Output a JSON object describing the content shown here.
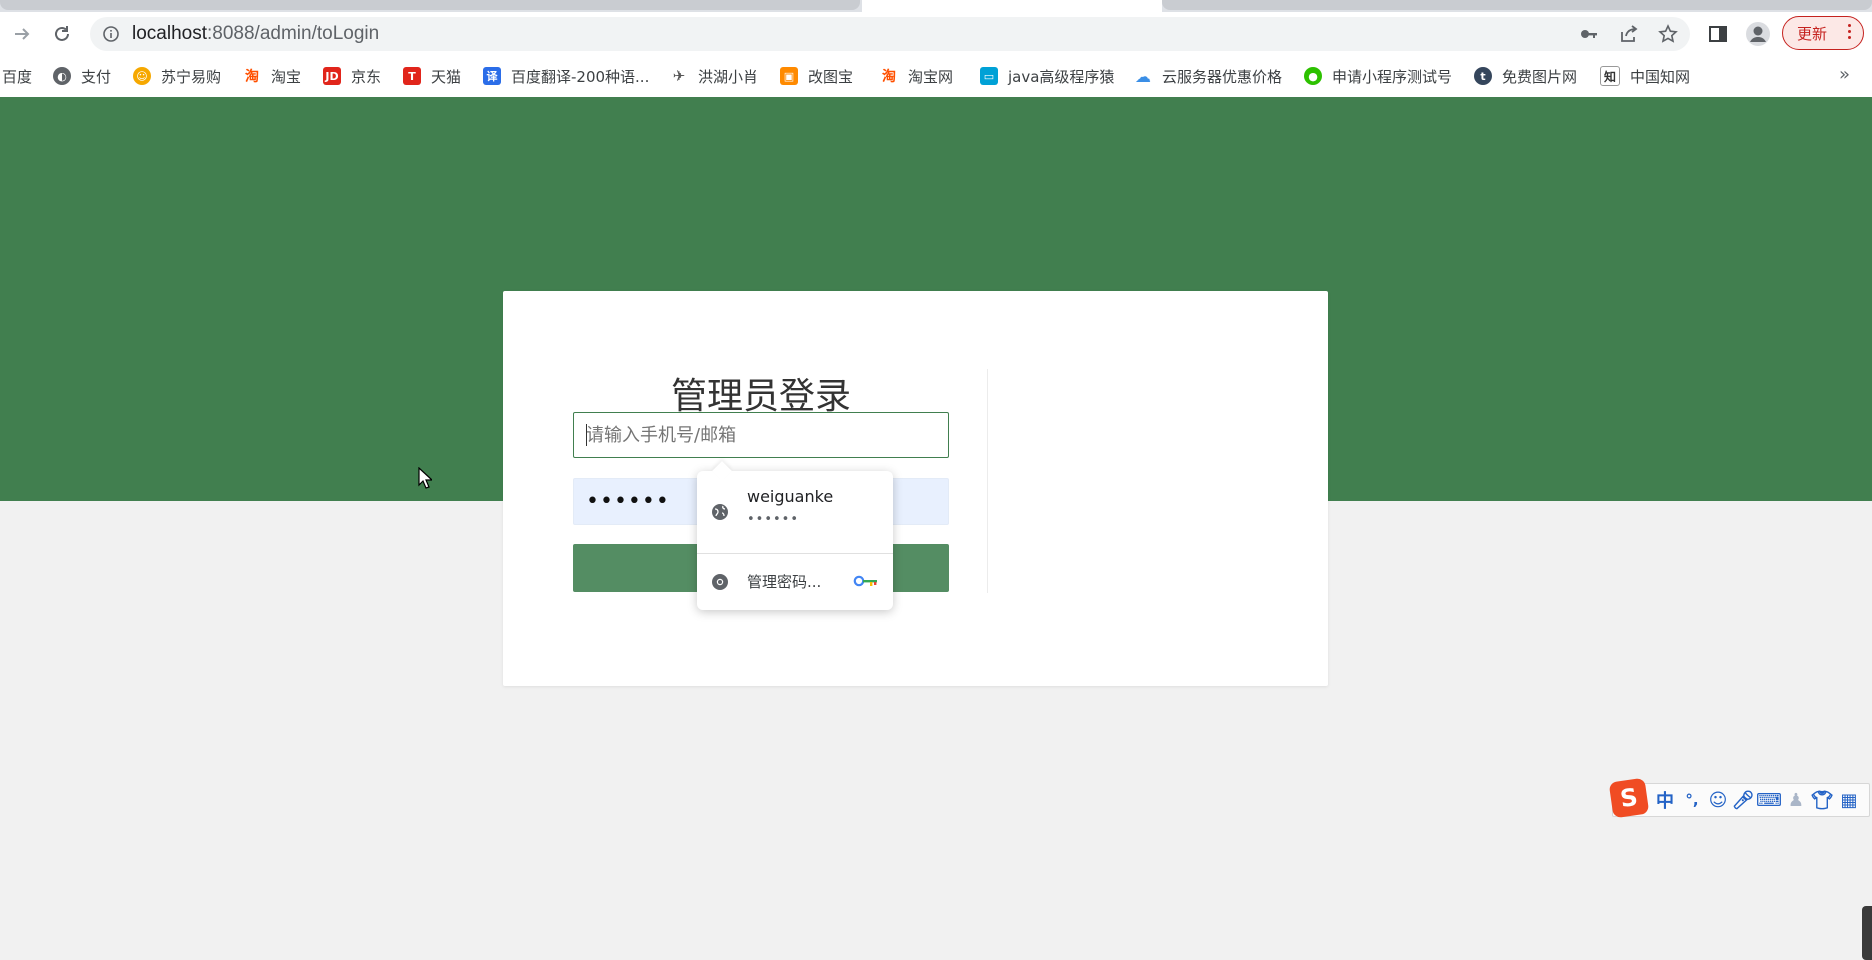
{
  "browser": {
    "url_host": "localhost",
    "url_path": ":8088/admin/toLogin",
    "update_label": "更新",
    "bookmarks": [
      {
        "label": "百度",
        "icon": "baidu-icon",
        "color": "#2932e1"
      },
      {
        "label": "支付",
        "icon": "globe-icon",
        "color": "#5f6368"
      },
      {
        "label": "苏宁易购",
        "icon": "suning-icon",
        "color": "#f6a800"
      },
      {
        "label": "淘宝",
        "icon": "taobao-icon",
        "color": "#ff5000"
      },
      {
        "label": "京东",
        "icon": "jd-icon",
        "color": "#e1251b"
      },
      {
        "label": "天猫",
        "icon": "tmall-icon",
        "color": "#e1251b"
      },
      {
        "label": "百度翻译-200种语...",
        "icon": "translate-icon",
        "color": "#2b6de8"
      },
      {
        "label": "洪湖小肖",
        "icon": "bird-icon",
        "color": "#555555"
      },
      {
        "label": "改图宝",
        "icon": "gaitubao-icon",
        "color": "#ff8a00"
      },
      {
        "label": "淘宝网",
        "icon": "taobao-icon",
        "color": "#ff5000"
      },
      {
        "label": "java高级程序猿",
        "icon": "bilibili-icon",
        "color": "#00a1d6"
      },
      {
        "label": "云服务器优惠价格",
        "icon": "cloud-icon",
        "color": "#3a8ee6"
      },
      {
        "label": "申请小程序测试号",
        "icon": "wechat-icon",
        "color": "#2dc100"
      },
      {
        "label": "免费图片网",
        "icon": "tumblr-icon",
        "color": "#35465c"
      },
      {
        "label": "中国知网",
        "icon": "cnki-icon",
        "color": "#333333"
      }
    ]
  },
  "login": {
    "title": "管理员登录",
    "username_placeholder": "请输入手机号/邮箱",
    "password_mask": "••••••"
  },
  "autofill": {
    "saved_user": "weiguanke",
    "saved_mask": "••••••",
    "manage_label": "管理密码..."
  },
  "ime": {
    "logo": "S",
    "mode": "中",
    "punct": "°,"
  },
  "colors": {
    "header_green": "#417f4f",
    "button_green": "#548d63",
    "update_red": "#c5221f"
  }
}
